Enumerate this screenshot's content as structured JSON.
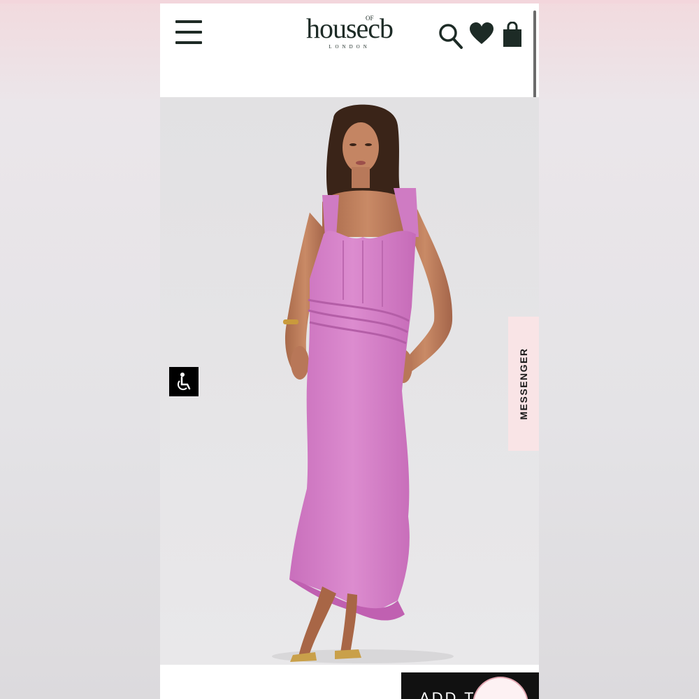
{
  "header": {
    "logo_main": "housecb",
    "logo_of": "OF",
    "logo_sub": "LONDON",
    "icons": [
      "menu-icon",
      "search-icon",
      "heart-icon",
      "bag-icon"
    ]
  },
  "side_tab": {
    "label": "MESSENGER"
  },
  "accessibility": {
    "icon": "accessibility-icon"
  },
  "cta": {
    "label": "ADD T"
  },
  "colors": {
    "brand_dark": "#1d2b26",
    "dress_pink": "#d77fc9",
    "hero_bg": "#e4e3e4",
    "messenger_bg": "#f9e4e6"
  }
}
